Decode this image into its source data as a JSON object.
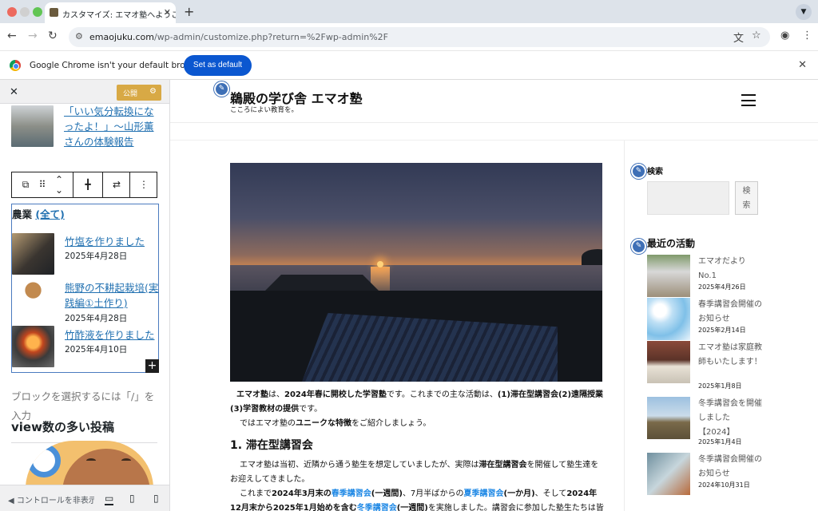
{
  "browser": {
    "tab_title": "カスタマイズ: エマオ塾へようこ",
    "url_host": "emaojuku.com",
    "url_path": "/wp-admin/customize.php?return=%2Fwp-admin%2F",
    "infobar_message": "Google Chrome isn't your default browser",
    "set_default_label": "Set as default"
  },
  "sidebar": {
    "publish_label": "公開",
    "top_post": {
      "title": "「いい気分転換になったよ！」～山形薫さんの体験報告"
    },
    "category": {
      "name": "農業",
      "all_link": "(全て)"
    },
    "posts": [
      {
        "title": "竹塩を作りました",
        "date": "2025年4月28日"
      },
      {
        "title": "熊野の不耕起栽培(実践編①土作り)",
        "date": "2025年4月28日"
      },
      {
        "title": "竹酢液を作りました",
        "date": "2025年4月10日"
      }
    ],
    "hint": "ブロックを選択するには「/」を入力",
    "popular_heading": "view数の多い投稿",
    "hide_controls": "コントロールを非表示"
  },
  "site": {
    "title": "鵜殿の学び舎 エマオ塾",
    "tagline": "こころによい教育を。",
    "intro_line1_a": "エマオ塾",
    "intro_line1_b": "は、",
    "intro_line1_c": "2024年春に開校した学習塾",
    "intro_line1_d": "です。これまでの主な活動は、",
    "intro_line1_e": "(1)滞在型講習会(2)遠隔授業(3)学習教材の提供",
    "intro_line1_f": "です。",
    "intro_line2_a": "では",
    "intro_line2_b": "エマオ塾",
    "intro_line2_c": "の",
    "intro_line2_d": "ユニークな特徴",
    "intro_line2_e": "をご紹介しましょう。",
    "section_heading": "1. 滞在型講習会",
    "para1_a": "エマオ塾は当初、近隣から通う塾生を想定していましたが、実際は",
    "para1_b": "滞在型講習会",
    "para1_c": "を開催して塾生達をお迎えしてきました。",
    "para2_a": "これまで",
    "para2_b": "2024年3月末の",
    "para2_c": "春季講習会",
    "para2_d": "(一週間)",
    "para2_e": "、7月半ばからの",
    "para2_f": "夏季講習会",
    "para2_g": "(一か月)",
    "para2_h": "、そして",
    "para2_i": "2024年12月末から2025年1月始めを含む",
    "para2_j": "冬季講習会",
    "para2_k": "(一週間)",
    "para2_l": "を実施しました。講習会に参加した塾生たちは皆遠方か"
  },
  "widgets": {
    "search_label": "検索",
    "search_button": "検索",
    "recent_label": "最近の活動",
    "recent": [
      {
        "title": "エマオだより No.1",
        "date": "2025年4月26日"
      },
      {
        "title": "春季講習会開催のお知らせ",
        "date": "2025年2月14日"
      },
      {
        "title": "エマオ塾は家庭教師もいたします！",
        "date": "2025年1月8日"
      },
      {
        "title": "冬季講習会を開催しました【2024】",
        "date": "2025年1月4日"
      },
      {
        "title": "冬季講習会開催のお知らせ",
        "date": "2024年10月31日"
      }
    ]
  },
  "colors": {
    "publish": "#d8a945",
    "link": "#2271b1",
    "accent_blue": "#1e88e5",
    "chrome_button": "#0b57d0"
  }
}
